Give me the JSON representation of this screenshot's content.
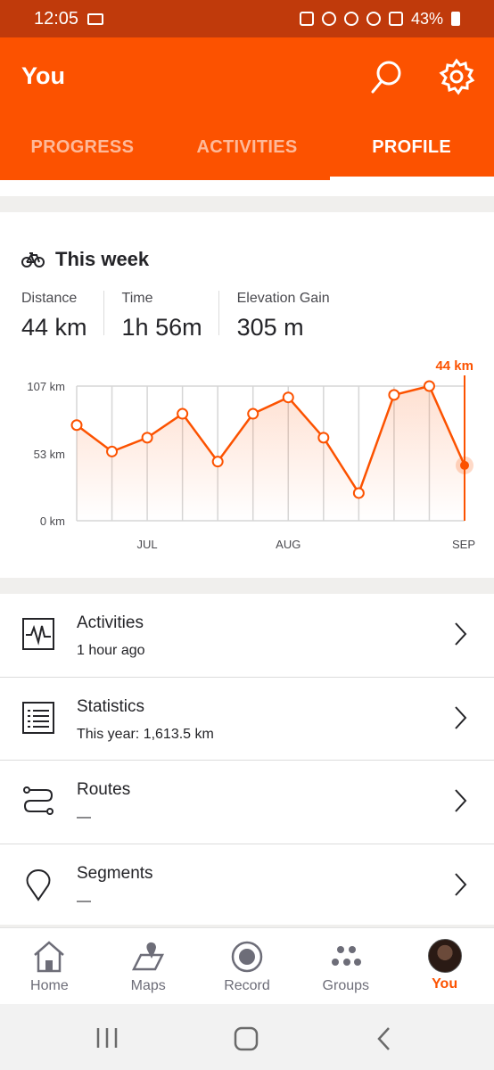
{
  "status_bar": {
    "time": "12:05",
    "battery": "43%"
  },
  "header": {
    "title": "You"
  },
  "tabs": [
    {
      "label": "PROGRESS"
    },
    {
      "label": "ACTIVITIES"
    },
    {
      "label": "PROFILE"
    }
  ],
  "week": {
    "title": "This week",
    "stats": [
      {
        "label": "Distance",
        "value": "44 km"
      },
      {
        "label": "Time",
        "value": "1h 56m"
      },
      {
        "label": "Elevation Gain",
        "value": "305 m"
      }
    ]
  },
  "chart_data": {
    "type": "line",
    "title": "",
    "xlabel": "",
    "ylabel": "",
    "y_ticks": [
      "107 km",
      "53 km",
      "0 km"
    ],
    "x_ticks": [
      "JUL",
      "AUG",
      "SEP"
    ],
    "ylim": [
      0,
      107
    ],
    "current_label": "44 km",
    "series": [
      {
        "values": [
          76,
          55,
          66,
          85,
          47,
          85,
          98,
          66,
          22,
          100,
          107,
          44
        ]
      }
    ],
    "color": "#fc5200"
  },
  "menu": [
    {
      "title": "Activities",
      "subtitle": "1 hour ago",
      "icon": "activity-pulse-icon"
    },
    {
      "title": "Statistics",
      "subtitle": "This year: 1,613.5 km",
      "icon": "statistics-list-icon"
    },
    {
      "title": "Routes",
      "subtitle": "—",
      "icon": "routes-icon"
    },
    {
      "title": "Segments",
      "subtitle": "—",
      "icon": "location-pin-icon"
    }
  ],
  "bottom_nav": [
    {
      "label": "Home",
      "icon": "home-icon"
    },
    {
      "label": "Maps",
      "icon": "maps-icon"
    },
    {
      "label": "Record",
      "icon": "record-icon"
    },
    {
      "label": "Groups",
      "icon": "groups-icon"
    },
    {
      "label": "You",
      "icon": "avatar"
    }
  ]
}
